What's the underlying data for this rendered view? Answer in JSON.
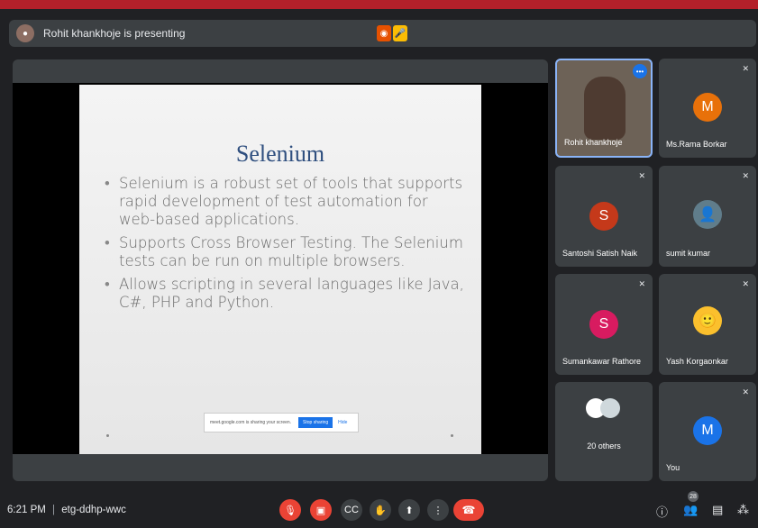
{
  "presenting": {
    "text": "Rohit khankhoje is presenting"
  },
  "slide": {
    "title": "Selenium",
    "bullets": [
      "Selenium is a robust set of tools that supports rapid development of test automation for web-based applications.",
      "Supports Cross Browser Testing. The Selenium tests can be run on multiple browsers.",
      "Allows scripting in several languages like Java, C#, PHP and Python."
    ],
    "share_notice": {
      "text": "meet.google.com is sharing your screen.",
      "stop": "Stop sharing",
      "hide": "Hide"
    }
  },
  "participants": [
    {
      "name": "Rohit khankhoje",
      "initial": "",
      "color": "#5d4037"
    },
    {
      "name": "Ms.Rama Borkar",
      "initial": "M",
      "color": "#e8710a"
    },
    {
      "name": "Santoshi Satish Naik",
      "initial": "S",
      "color": "#c5391a"
    },
    {
      "name": "sumit kumar",
      "initial": "",
      "color": "#607d8b"
    },
    {
      "name": "Sumankawar Rathore",
      "initial": "S",
      "color": "#d81b60"
    },
    {
      "name": "Yash Korgaonkar",
      "initial": "",
      "color": "#fbc02d"
    },
    {
      "name": "20 others",
      "initial": "",
      "color": "#ffffff"
    },
    {
      "name": "You",
      "initial": "M",
      "color": "#1a73e8"
    }
  ],
  "bottom": {
    "time": "6:21 PM",
    "separator": "|",
    "meeting_code": "etg-ddhp-wwc",
    "participant_count": "28"
  }
}
